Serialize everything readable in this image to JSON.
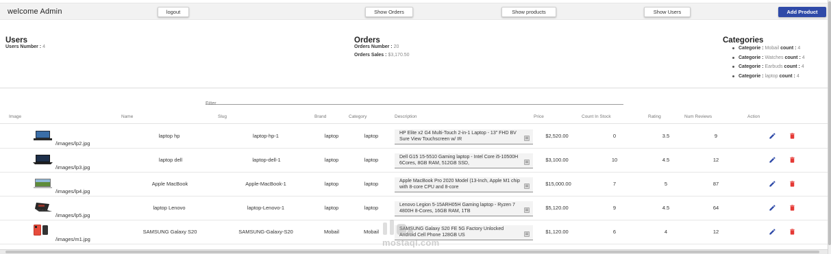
{
  "header": {
    "welcome": "welcome Admin",
    "logout_label": "logout",
    "show_orders_label": "Show Orders",
    "show_products_label": "Show products",
    "show_users_label": "Show Users",
    "add_product_label": "Add Product"
  },
  "users": {
    "title": "Users",
    "number_label": "Users Number :",
    "number_value": "4"
  },
  "orders": {
    "title": "Orders",
    "number_label": "Orders Number :",
    "number_value": "20",
    "sales_label": "Orders Sales :",
    "sales_value": "$3,170.50"
  },
  "categories": {
    "title": "Categories",
    "item_label": "Categorie :",
    "count_label": "count :",
    "items": [
      {
        "name": "Mobail",
        "count": "4"
      },
      {
        "name": "Watches",
        "count": "4"
      },
      {
        "name": "Earbuds",
        "count": "4"
      },
      {
        "name": "laptop",
        "count": "4"
      }
    ]
  },
  "filter": {
    "placeholder": "Filter"
  },
  "table": {
    "columns": {
      "image": "Image",
      "name": "Name",
      "slug": "Slug",
      "brand": "Brand",
      "category": "Category",
      "description": "Description",
      "price": "Price",
      "stock": "Count In Stock",
      "rating": "Rating",
      "reviews": "Num Reviews",
      "action": "Action"
    },
    "rows": [
      {
        "image": "/images/lp2.jpg",
        "name": "laptop hp",
        "slug": "laptop-hp-1",
        "brand": "laptop",
        "category": "laptop",
        "description": "HP Elite x2 G4 Multi-Touch 2-in-1 Laptop - 13\" FHD BV Sure View Touchscreen w/ IR",
        "price": "$2,520.00",
        "stock": "0",
        "rating": "3.5",
        "reviews": "9"
      },
      {
        "image": "/images/lp3.jpg",
        "name": "laptop dell",
        "slug": "laptop-dell-1",
        "brand": "laptop",
        "category": "laptop",
        "description": "Dell G15 15-5510 Gaming laptop - Intel Core i5-10500H 6Cores, 8GB RAM, 512GB SSD,",
        "price": "$3,100.00",
        "stock": "10",
        "rating": "4.5",
        "reviews": "12"
      },
      {
        "image": "/images/lp4.jpg",
        "name": "Apple MacBook",
        "slug": "Apple-MacBook-1",
        "brand": "laptop",
        "category": "laptop",
        "description": "Apple MacBook Pro 2020 Model (13-Inch, Apple M1 chip with 8-core CPU and 8-core",
        "price": "$15,000.00",
        "stock": "7",
        "rating": "5",
        "reviews": "87"
      },
      {
        "image": "/images/lp5.jpg",
        "name": "laptop Lenovo",
        "slug": "laptop-Lenovo-1",
        "brand": "laptop",
        "category": "laptop",
        "description": "Lenovo Legion 5-15ARH05H Gaming laptop - Ryzen 7 4800H 8-Cores, 16GB RAM, 1TB",
        "price": "$5,120.00",
        "stock": "9",
        "rating": "4.5",
        "reviews": "64"
      },
      {
        "image": "/images/m1.jpg",
        "name": "SAMSUNG Galaxy S20",
        "slug": "SAMSUNG-Galaxy-S20",
        "brand": "Mobail",
        "category": "Mobail",
        "description": "SAMSUNG Galaxy S20 FE 5G Factory Unlocked Android Cell Phone 128GB US",
        "price": "$1,120.00",
        "stock": "6",
        "rating": "4",
        "reviews": "12"
      }
    ]
  },
  "watermark": {
    "text": "mostaql.com"
  },
  "colors": {
    "primary": "#2f4aa8",
    "edit": "#2f4aa8",
    "delete": "#e53935",
    "topbar": "#f2f2f2"
  },
  "icons": {
    "edit": "pencil-icon",
    "delete": "trash-icon"
  }
}
